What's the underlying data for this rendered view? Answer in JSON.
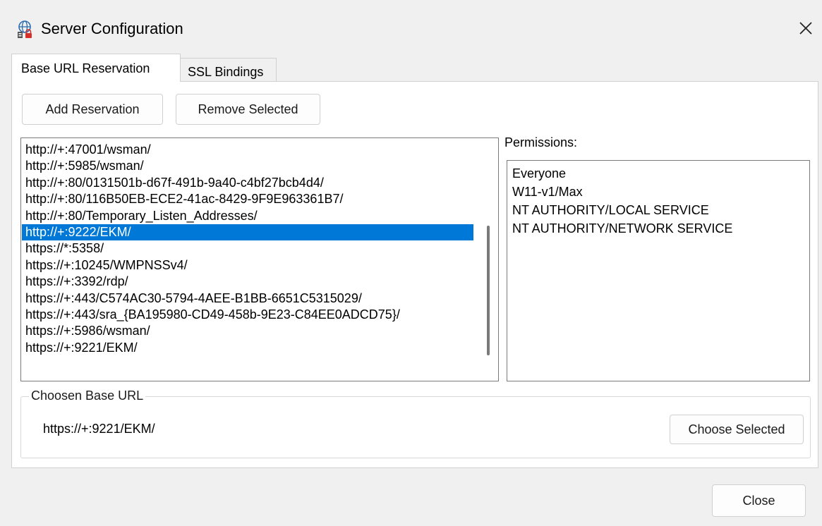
{
  "window": {
    "title": "Server Configuration",
    "app_icon": "globe-lock-icon",
    "close_glyph": "✕"
  },
  "tabs": [
    {
      "label": "Base URL Reservation",
      "active": true
    },
    {
      "label": "SSL Bindings",
      "active": false
    }
  ],
  "toolbar": {
    "add_label": "Add Reservation",
    "remove_label": "Remove Selected"
  },
  "url_list": {
    "items": [
      "http://+:47001/wsman/",
      "http://+:5985/wsman/",
      "http://+:80/0131501b-d67f-491b-9a40-c4bf27bcb4d4/",
      "http://+:80/116B50EB-ECE2-41ac-8429-9F9E963361B7/",
      "http://+:80/Temporary_Listen_Addresses/",
      "http://+:9222/EKM/",
      "https://*:5358/",
      "https://+:10245/WMPNSSv4/",
      "https://+:3392/rdp/",
      "https://+:443/C574AC30-5794-4AEE-B1BB-6651C5315029/",
      "https://+:443/sra_{BA195980-CD49-458b-9E23-C84EE0ADCD75}/",
      "https://+:5986/wsman/",
      "https://+:9221/EKM/"
    ],
    "selected_index": 5
  },
  "permissions": {
    "label": "Permissions:",
    "items": [
      "Everyone",
      "W11-v1/Max",
      "NT AUTHORITY/LOCAL SERVICE",
      "NT AUTHORITY/NETWORK SERVICE"
    ]
  },
  "chosen": {
    "group_label": "Choosen Base URL",
    "value": "https://+:9221/EKM/",
    "button_label": "Choose Selected"
  },
  "footer": {
    "close_label": "Close"
  },
  "colors": {
    "selection": "#0078d7",
    "background": "#f0f0f0",
    "icon_accent": "#d6302b",
    "icon_blue": "#2b6cb0"
  }
}
